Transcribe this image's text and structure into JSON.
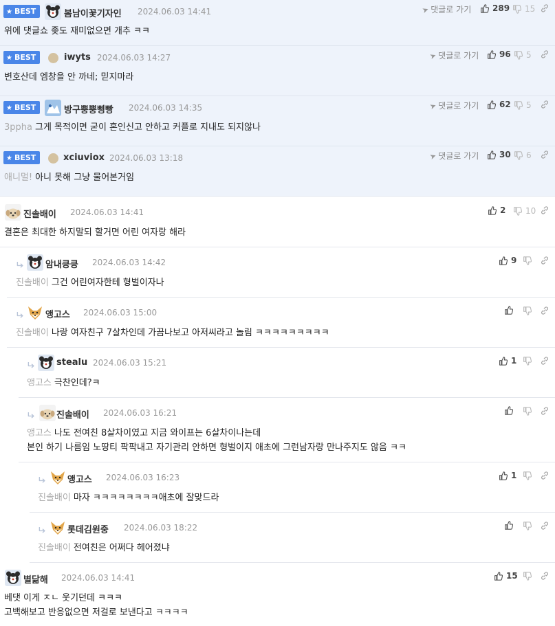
{
  "best_badge_label": "BEST",
  "goto_label": "댓글로 가기",
  "colors": {
    "best_bg": "#eef3fb",
    "badge": "#4a86e8",
    "mention": "#aaaaaa"
  },
  "comments": [
    {
      "author": "봄남이꽃기자인",
      "date": "2024.06.03 14:41",
      "up": "289",
      "down": "15",
      "mention": "",
      "lines": [
        "위에 댓글쇼 좆도 재미없으면 개추 ㅋㅋ"
      ]
    },
    {
      "author": "iwyts",
      "date": "2024.06.03 14:27",
      "up": "96",
      "down": "5",
      "mention": "",
      "lines": [
        "변호산데 엠창을 안 까네; 믿지마라"
      ]
    },
    {
      "author": "방구뿡뿡삥빵",
      "date": "2024.06.03 14:35",
      "up": "62",
      "down": "5",
      "mention": "3ppha",
      "lines": [
        "그게 목적이면 굳이 혼인신고 안하고 커플로 지내도 되지않나"
      ]
    },
    {
      "author": "xciuviox",
      "date": "2024.06.03 13:18",
      "up": "30",
      "down": "6",
      "mention": "애니멀!",
      "lines": [
        "아니 못해 그냥 물어본거임"
      ]
    },
    {
      "author": "진솔배이",
      "date": "2024.06.03 14:41",
      "up": "2",
      "down": "10",
      "mention": "",
      "lines": [
        "결혼은 최대한 하지말되 할거면 어린 여자랑 해라"
      ]
    },
    {
      "author": "암내킁킁",
      "date": "2024.06.03 14:42",
      "up": "9",
      "down": "",
      "mention": "진솔배이",
      "lines": [
        "그건 어린여자한테 형벌이자나"
      ]
    },
    {
      "author": "앵고스",
      "date": "2024.06.03 15:00",
      "up": "",
      "down": "",
      "mention": "진솔배이",
      "lines": [
        "나랑 여자친구 7살차인데 가끔나보고 아저씨라고 놀림 ㅋㅋㅋㅋㅋㅋㅋㅋㅋ"
      ]
    },
    {
      "author": "stealu",
      "date": "2024.06.03 15:21",
      "up": "1",
      "down": "",
      "mention": "앵고스",
      "lines": [
        "극찬인데?ㅋ"
      ]
    },
    {
      "author": "진솔배이",
      "date": "2024.06.03 16:21",
      "up": "",
      "down": "",
      "mention": "앵고스",
      "lines": [
        "나도 전여친 8살차이였고 지금 와이프는 6살차이나는데",
        "본인 하기 나름임 노땅티 팍팍내고 자기관리 안하면 형벌이지 애초에 그런남자랑 만나주지도 않음 ㅋㅋ"
      ]
    },
    {
      "author": "앵고스",
      "date": "2024.06.03 16:23",
      "up": "1",
      "down": "",
      "mention": "진솔배이",
      "lines": [
        "마자 ㅋㅋㅋㅋㅋㅋㅋㅋ애초에 잘맞드라"
      ]
    },
    {
      "author": "롯데김원중",
      "date": "2024.06.03 18:22",
      "up": "",
      "down": "",
      "mention": "진솔배이",
      "lines": [
        "전여친은 어쩌다 헤어졌냐"
      ]
    },
    {
      "author": "별닮해",
      "date": "2024.06.03 14:41",
      "up": "15",
      "down": "",
      "mention": "",
      "lines": [
        "베댓 이게 ㅈㄴ 웃기던데 ㅋㅋㅋ",
        "고백해보고 반응없으면 저걸로 보낸다고 ㅋㅋㅋㅋ"
      ]
    }
  ]
}
